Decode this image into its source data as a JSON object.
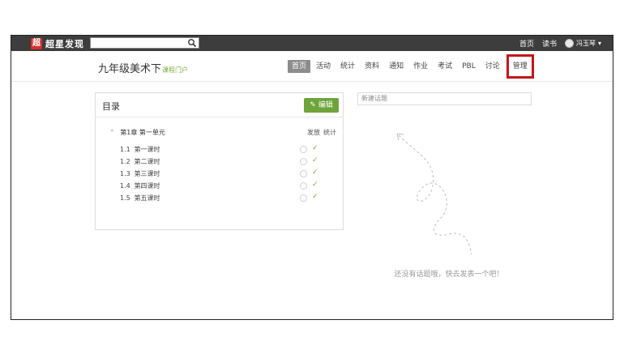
{
  "topbar": {
    "logo_mark": "超",
    "logo_text": "超星发现",
    "search_placeholder": "",
    "links": [
      "首页",
      "读书"
    ],
    "user_name": "冯玉琴",
    "user_caret": "▾"
  },
  "course": {
    "title": "九年级美术下",
    "subtitle": "课程门户"
  },
  "nav": {
    "items": [
      "首页",
      "活动",
      "统计",
      "资料",
      "通知",
      "作业",
      "考试",
      "PBL",
      "讨论",
      "管理"
    ]
  },
  "catalog": {
    "title": "目录",
    "edit_label": "编辑",
    "chapter": "第1章 第一单元",
    "col_publish": "发放",
    "col_stats": "统计",
    "lessons": [
      {
        "num": "1.1",
        "name": "第一课时"
      },
      {
        "num": "1.2",
        "name": "第二课时"
      },
      {
        "num": "1.3",
        "name": "第三课时"
      },
      {
        "num": "1.4",
        "name": "第四课时"
      },
      {
        "num": "1.5",
        "name": "第五课时"
      }
    ]
  },
  "discussion": {
    "new_topic_placeholder": "新建话题",
    "empty_text": "还没有话题哦，快去发表一个吧！"
  },
  "colors": {
    "accent_green": "#6ea43a",
    "highlight_red": "#c0171b",
    "topbar": "#3d3d3d"
  }
}
